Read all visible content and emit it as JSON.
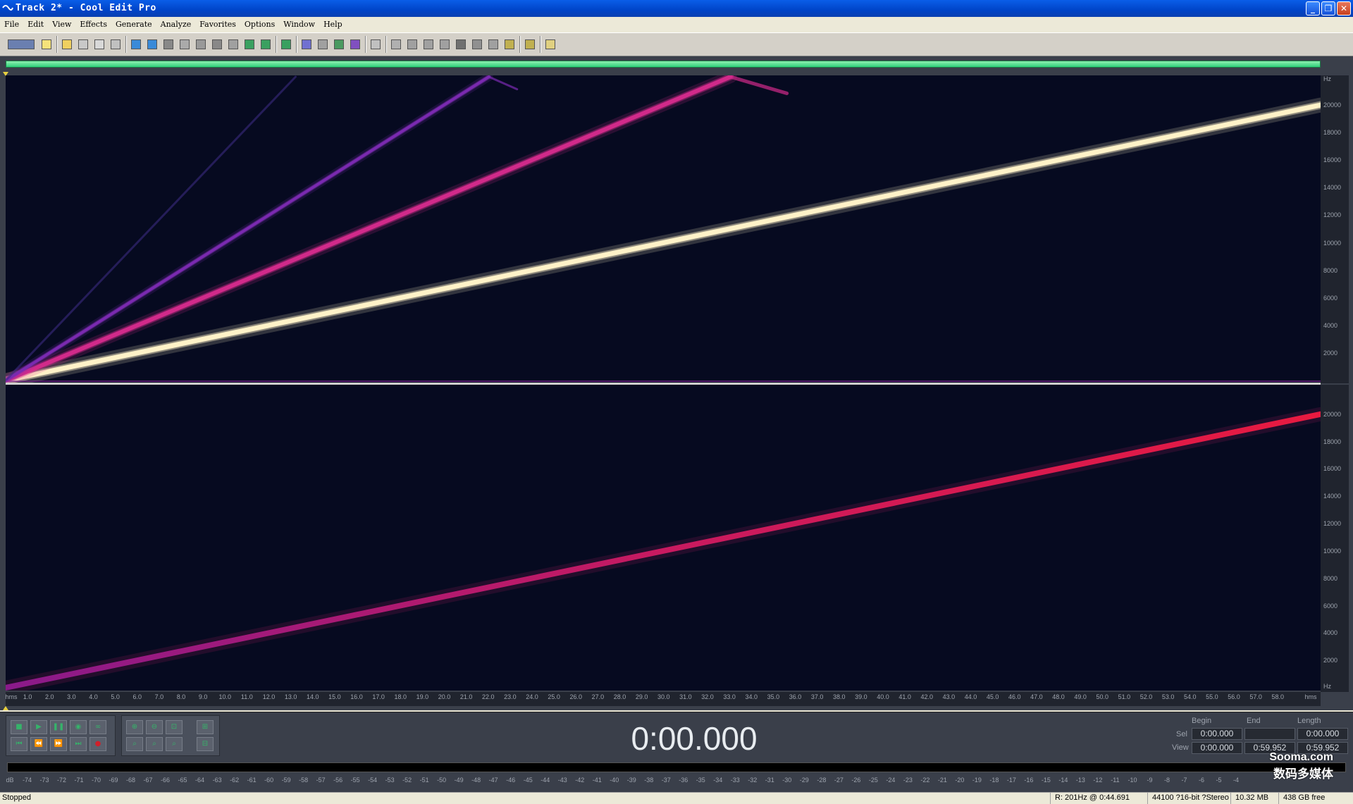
{
  "window": {
    "title": "Track 2* - Cool Edit Pro"
  },
  "menu": [
    "File",
    "Edit",
    "View",
    "Effects",
    "Generate",
    "Analyze",
    "Favorites",
    "Options",
    "Window",
    "Help"
  ],
  "toolbar": {
    "buttons": [
      "waveform-view-toggle",
      "new",
      "open",
      "close",
      "save",
      "save-all",
      "undo",
      "redo",
      "repeat-last",
      "select-all",
      "cut",
      "copy",
      "paste",
      "paste-new",
      "mix-paste",
      "trim",
      "spectral-view",
      "waveform-view",
      "pan-view",
      "phase-view",
      "snap",
      "envelope",
      "zoom-in",
      "zoom-out",
      "loop",
      "cd-player",
      "metronome",
      "cue-list",
      "settings",
      "help-context",
      "help"
    ]
  },
  "time_ruler": {
    "start_label": "hms",
    "end_label": "hms",
    "ticks": [
      "1.0",
      "2.0",
      "3.0",
      "4.0",
      "5.0",
      "6.0",
      "7.0",
      "8.0",
      "9.0",
      "10.0",
      "11.0",
      "12.0",
      "13.0",
      "14.0",
      "15.0",
      "16.0",
      "17.0",
      "18.0",
      "19.0",
      "20.0",
      "21.0",
      "22.0",
      "23.0",
      "24.0",
      "25.0",
      "26.0",
      "27.0",
      "28.0",
      "29.0",
      "30.0",
      "31.0",
      "32.0",
      "33.0",
      "34.0",
      "35.0",
      "36.0",
      "37.0",
      "38.0",
      "39.0",
      "40.0",
      "41.0",
      "42.0",
      "43.0",
      "44.0",
      "45.0",
      "46.0",
      "47.0",
      "48.0",
      "49.0",
      "50.0",
      "51.0",
      "52.0",
      "53.0",
      "54.0",
      "55.0",
      "56.0",
      "57.0",
      "58.0"
    ]
  },
  "freq_ruler": {
    "unit_label": "Hz",
    "upper_ticks": [
      "20000",
      "18000",
      "16000",
      "14000",
      "12000",
      "10000",
      "8000",
      "6000",
      "4000",
      "2000"
    ],
    "lower_ticks": [
      "20000",
      "18000",
      "16000",
      "14000",
      "12000",
      "10000",
      "8000",
      "6000",
      "4000",
      "2000"
    ],
    "bottom_unit_label": "Hz"
  },
  "spectrogram": {
    "duration_s": 59.952,
    "max_freq_hz": 22050,
    "sweep_end_hz": 20000,
    "upper_color": "#fff2c8",
    "harmonic_colors": [
      "#d12a8a",
      "#7a2ab0"
    ],
    "lower_color": "#e81a40",
    "background": "#060a20"
  },
  "transport": {
    "time_display": "0:00.000",
    "buttons_row1": [
      "stop",
      "play",
      "pause",
      "play-to-end",
      "loop"
    ],
    "buttons_row2": [
      "go-to-start",
      "rewind",
      "fast-forward",
      "go-to-end",
      "record"
    ],
    "zoom_buttons": [
      "zoom-in-horizontal",
      "zoom-out-horizontal",
      "zoom-full",
      "zoom-selection",
      "zoom-in-vertical",
      "zoom-out-vertical",
      "zoom-left",
      "zoom-right"
    ]
  },
  "selection": {
    "headers": [
      "Begin",
      "End",
      "Length"
    ],
    "sel_label": "Sel",
    "view_label": "View",
    "sel_begin": "0:00.000",
    "sel_end": "",
    "sel_length": "0:00.000",
    "view_begin": "0:00.000",
    "view_end": "0:59.952",
    "view_length": "0:59.952"
  },
  "level_meter": {
    "ticks": [
      "dB",
      "-74",
      "-73",
      "-72",
      "-71",
      "-70",
      "-69",
      "-68",
      "-67",
      "-66",
      "-65",
      "-64",
      "-63",
      "-62",
      "-61",
      "-60",
      "-59",
      "-58",
      "-57",
      "-56",
      "-55",
      "-54",
      "-53",
      "-52",
      "-51",
      "-50",
      "-49",
      "-48",
      "-47",
      "-46",
      "-45",
      "-44",
      "-43",
      "-42",
      "-41",
      "-40",
      "-39",
      "-38",
      "-37",
      "-36",
      "-35",
      "-34",
      "-33",
      "-32",
      "-31",
      "-30",
      "-29",
      "-28",
      "-27",
      "-26",
      "-25",
      "-24",
      "-23",
      "-22",
      "-21",
      "-20",
      "-19",
      "-18",
      "-17",
      "-16",
      "-15",
      "-14",
      "-13",
      "-12",
      "-11",
      "-10",
      "-9",
      "-8",
      "-7",
      "-6",
      "-5",
      "-4"
    ]
  },
  "watermark": {
    "line1": "Sooma.com",
    "line2": "数码多媒体"
  },
  "status": {
    "state": "Stopped",
    "cursor": "R: 201Hz @ 0:44.691",
    "format": "44100 ?16-bit ?Stereo",
    "size": "10.32 MB",
    "free": "438 GB free"
  }
}
